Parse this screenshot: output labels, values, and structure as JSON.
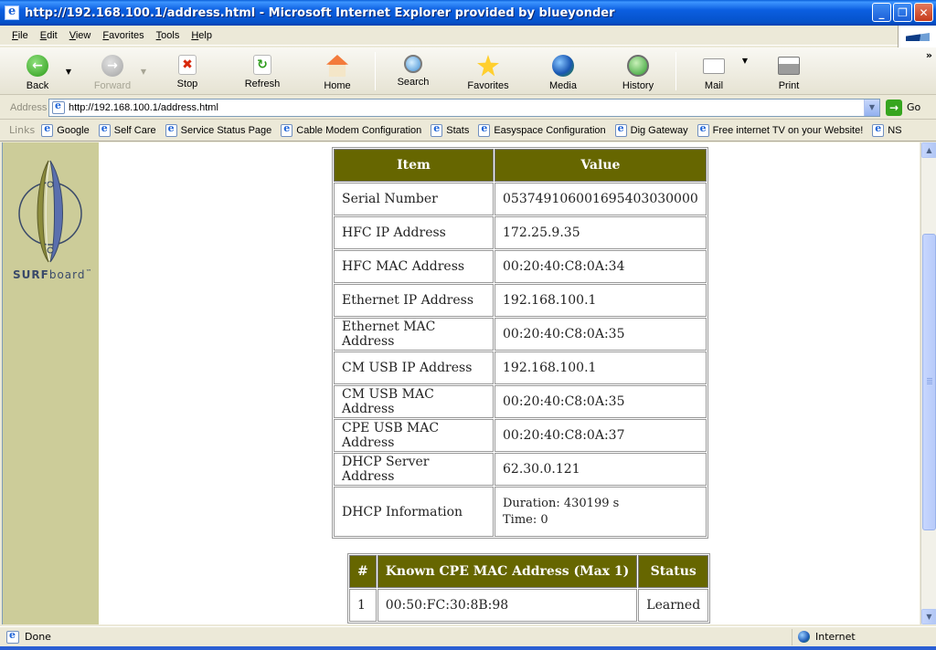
{
  "window": {
    "title": "http://192.168.100.1/address.html - Microsoft Internet Explorer provided by blueyonder"
  },
  "menu": [
    "File",
    "Edit",
    "View",
    "Favorites",
    "Tools",
    "Help"
  ],
  "toolbar": {
    "back": "Back",
    "forward": "Forward",
    "stop": "Stop",
    "refresh": "Refresh",
    "home": "Home",
    "search": "Search",
    "favorites": "Favorites",
    "media": "Media",
    "history": "History",
    "mail": "Mail",
    "print": "Print"
  },
  "address": {
    "label": "Address",
    "url": "http://192.168.100.1/address.html",
    "go": "Go"
  },
  "links": {
    "label": "Links",
    "items": [
      "Google",
      "Self Care",
      "Service Status Page",
      "Cable Modem Configuration",
      "Stats",
      "Easyspace Configuration",
      "Dig Gateway",
      "Free internet TV on your Website!",
      "NS"
    ]
  },
  "page": {
    "logo_text_bold": "SURF",
    "logo_text_rest": "board",
    "logo_mark": "™",
    "info_table": {
      "headers": [
        "Item",
        "Value"
      ],
      "rows": [
        {
          "item": "Serial Number",
          "value": "053749106001695403030000"
        },
        {
          "item": "HFC IP Address",
          "value": "172.25.9.35"
        },
        {
          "item": "HFC MAC Address",
          "value": "00:20:40:C8:0A:34"
        },
        {
          "item": "Ethernet IP Address",
          "value": "192.168.100.1"
        },
        {
          "item": "Ethernet MAC Address",
          "value": "00:20:40:C8:0A:35"
        },
        {
          "item": "CM USB IP Address",
          "value": "192.168.100.1"
        },
        {
          "item": "CM USB MAC Address",
          "value": "00:20:40:C8:0A:35"
        },
        {
          "item": "CPE USB MAC Address",
          "value": "00:20:40:C8:0A:37"
        },
        {
          "item": "DHCP Server Address",
          "value": "62.30.0.121"
        }
      ],
      "dhcp_info": {
        "item": "DHCP Information",
        "duration": "Duration: 430199 s",
        "time": "Time: 0"
      }
    },
    "cpe_table": {
      "headers": [
        "#",
        "Known CPE MAC Address (Max 1)",
        "Status"
      ],
      "rows": [
        {
          "num": "1",
          "mac": "00:50:FC:30:8B:98",
          "status": "Learned"
        }
      ]
    }
  },
  "status": {
    "text": "Done",
    "zone": "Internet"
  }
}
